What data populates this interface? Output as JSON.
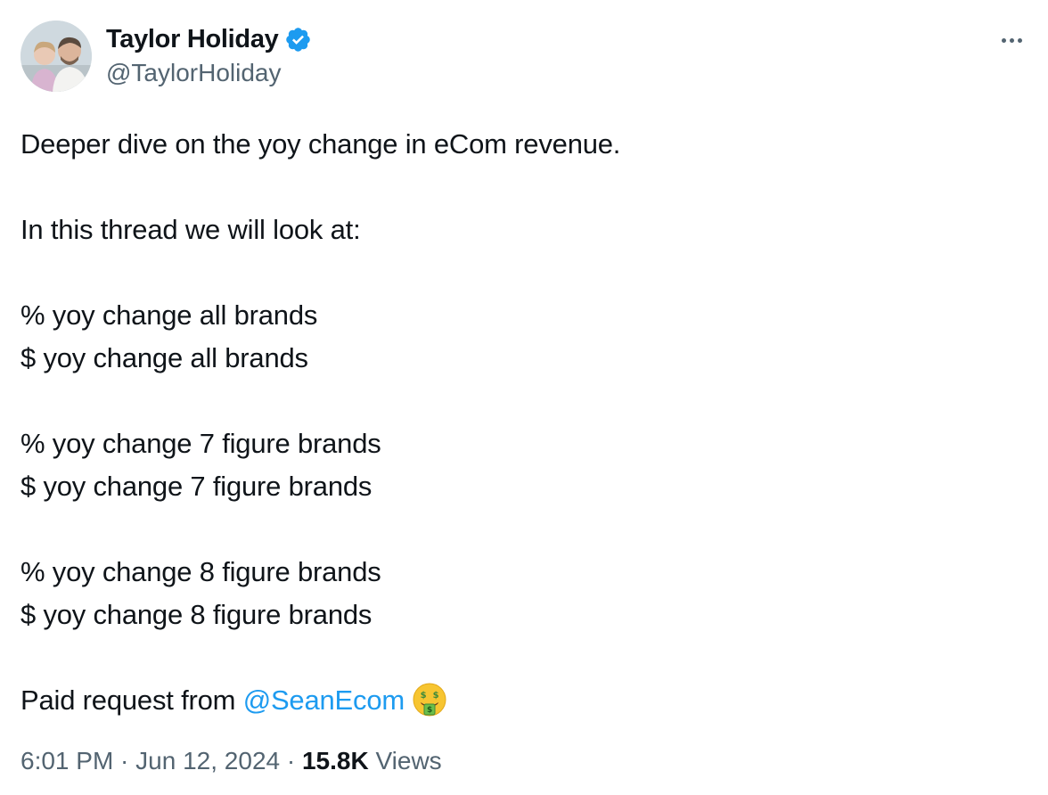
{
  "author": {
    "display_name": "Taylor Holiday",
    "handle": "@TaylorHoliday",
    "verified": true,
    "avatar_icon": "avatar-photo"
  },
  "menu": {
    "icon": "more-options-icon"
  },
  "tweet": {
    "lines": [
      "Deeper dive on the yoy change in eCom revenue.",
      "",
      "In this thread we will look at:",
      "",
      "% yoy change all brands",
      "$ yoy change all brands",
      "",
      "% yoy change 7 figure brands",
      "$ yoy change 7 figure brands",
      "",
      "% yoy change 8 figure brands",
      "$ yoy change 8 figure brands",
      ""
    ],
    "last_line_prefix": "Paid request from ",
    "mention": "@SeanEcom",
    "emoji_icon": "money-mouth-face-icon"
  },
  "meta": {
    "time": "6:01 PM",
    "separator": " · ",
    "date": "Jun 12, 2024",
    "views_count": "15.8K",
    "views_label": " Views"
  },
  "colors": {
    "text": "#0f1419",
    "secondary": "#536471",
    "link": "#1d9bf0",
    "verified": "#1d9bf0"
  }
}
